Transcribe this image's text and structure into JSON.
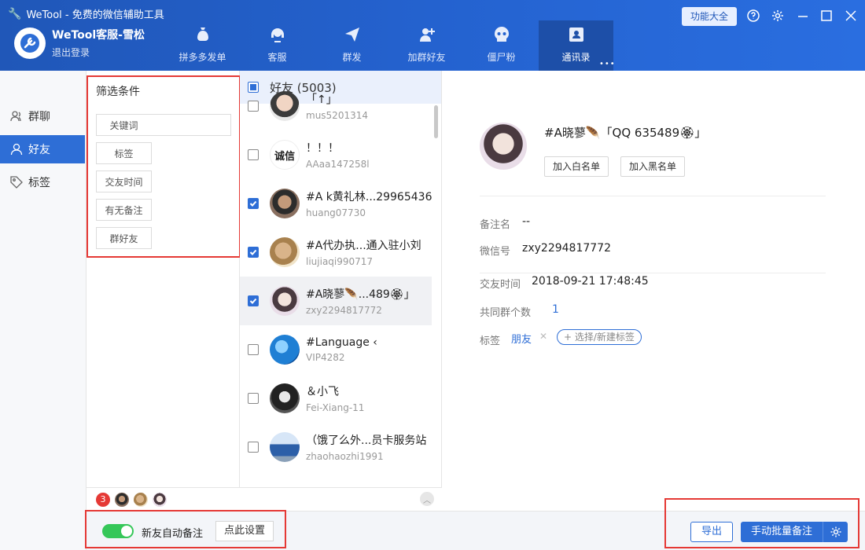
{
  "app": {
    "title": "WeTool - 免费的微信辅助工具",
    "account_name": "WeTool客服-雪松",
    "logout": "退出登录",
    "features_button": "功能大全"
  },
  "nav": [
    {
      "label": "拼多多发单",
      "icon": "money-bag-icon"
    },
    {
      "label": "客服",
      "icon": "headset-icon"
    },
    {
      "label": "群发",
      "icon": "send-plane-icon"
    },
    {
      "label": "加群好友",
      "icon": "add-user-icon"
    },
    {
      "label": "僵尸粉",
      "icon": "skull-icon"
    },
    {
      "label": "通讯录",
      "icon": "contacts-icon",
      "active": true
    }
  ],
  "sidebar": {
    "items": [
      {
        "label": "群聊",
        "icon": "group-icon"
      },
      {
        "label": "好友",
        "icon": "user-icon",
        "active": true
      },
      {
        "label": "标签",
        "icon": "tag-icon"
      }
    ]
  },
  "filter": {
    "title": "筛选条件",
    "keyword_label": "关键词",
    "keyword_value": "",
    "buttons": [
      "标签",
      "交友时间",
      "有无备注",
      "群好友"
    ]
  },
  "friends": {
    "header": "好友 (5003)",
    "rows": [
      {
        "name": "「↑」",
        "id": "mus5201314",
        "checked": false
      },
      {
        "name": "！！！",
        "id": "AAaa147258l",
        "checked": false
      },
      {
        "name": "#A  k黄礼林...29965436",
        "id": "huang07730",
        "checked": true
      },
      {
        "name": "#A代办执...通入驻小刘",
        "id": "liujiaqi990717",
        "checked": true
      },
      {
        "name": "#A晓蓼🪶...489🏵」",
        "id": "zxy2294817772",
        "checked": true,
        "selected": true
      },
      {
        "name": "#Language ‹",
        "id": "VIP4282",
        "checked": false
      },
      {
        "name": "＆小飞",
        "id": "Fei-Xiang-11",
        "checked": false
      },
      {
        "name": "（饿了么外...员卡服务站",
        "id": "zhaohaozhi1991",
        "checked": false
      }
    ]
  },
  "selected_bar": {
    "count": "3"
  },
  "detail": {
    "name": "#A晓蓼🪶「QQ 635489🏵」",
    "whitelist_btn": "加入白名单",
    "blacklist_btn": "加入黑名单",
    "remark_label": "备注名",
    "remark_value": "--",
    "wxid_label": "微信号",
    "wxid_value": "zxy2294817772",
    "friend_time_label": "交友时间",
    "friend_time_value": "2018-09-21 17:48:45",
    "common_groups_label": "共同群个数",
    "common_groups_value": "1",
    "tag_label": "标签",
    "tag_value": "朋友",
    "tag_add": "+ 选择/新建标签"
  },
  "bottom": {
    "auto_remark_label": "新友自动备注",
    "settings_btn": "点此设置",
    "export_btn": "导出",
    "batch_remark_btn": "手动批量备注"
  },
  "colors": {
    "header_blue": "#2462cf",
    "accent": "#2e6ed6",
    "annotation_red": "#e53935",
    "toggle_green": "#35c759"
  }
}
